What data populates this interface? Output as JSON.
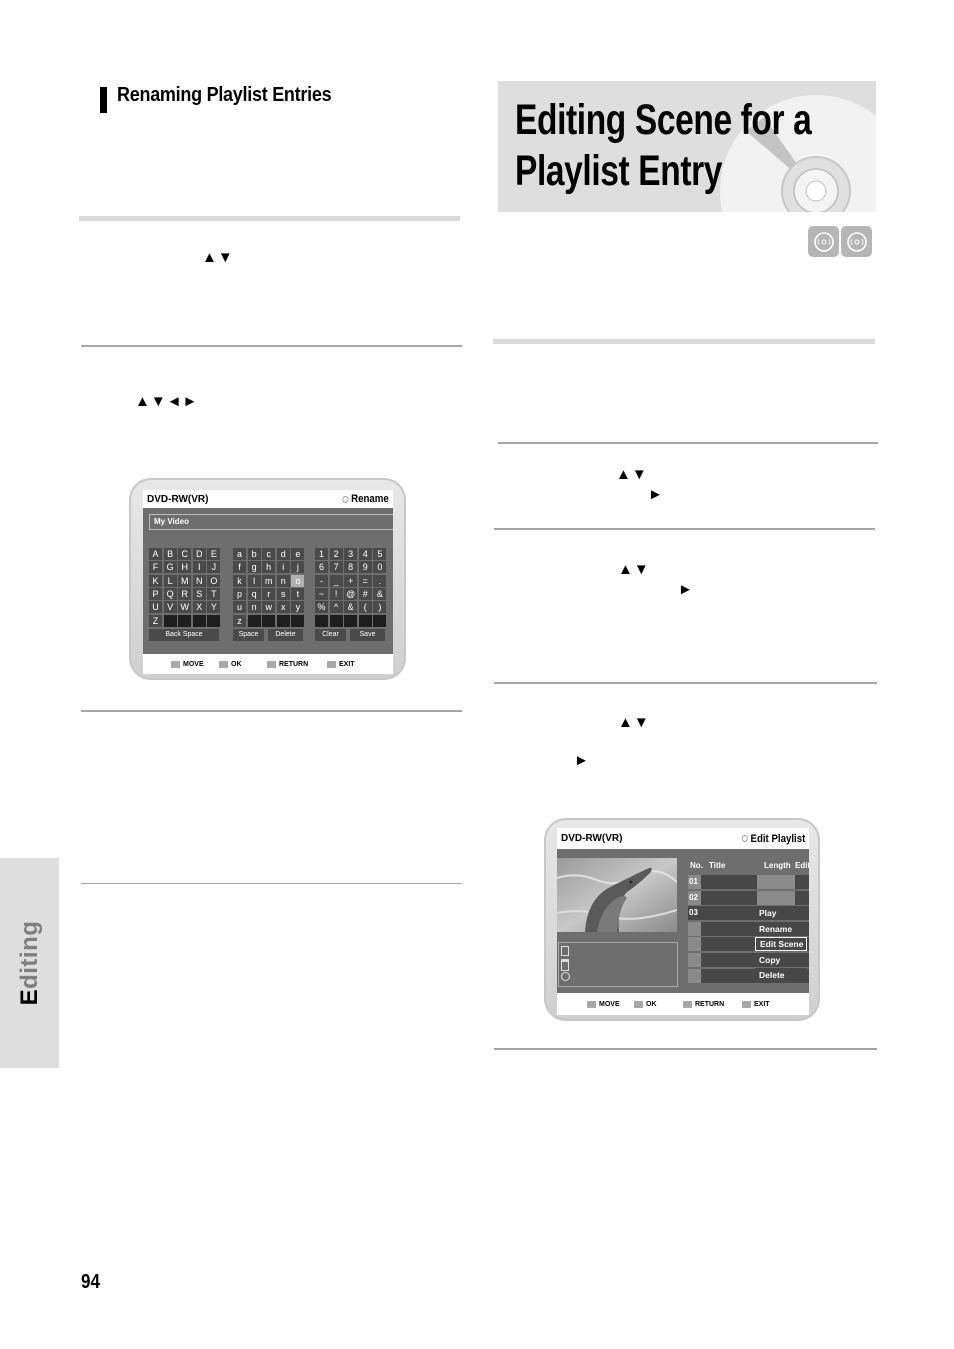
{
  "page": {
    "number": "94",
    "side_tab": {
      "first_letter": "E",
      "rest": "diting"
    }
  },
  "left_column": {
    "section_title": "Renaming Playlist Entries",
    "step_arrows": [
      "▲▼",
      "▲▼◄►"
    ],
    "rename_screen": {
      "disc_label": "DVD-RW(VR)",
      "mode_label": "Rename",
      "name_value": "My Video",
      "uppercase_keys": [
        "A",
        "B",
        "C",
        "D",
        "E",
        "F",
        "G",
        "H",
        "I",
        "J",
        "K",
        "L",
        "M",
        "N",
        "O",
        "P",
        "Q",
        "R",
        "S",
        "T",
        "U",
        "V",
        "W",
        "X",
        "Y",
        "Z",
        "",
        "",
        "",
        ""
      ],
      "lowercase_keys": [
        "a",
        "b",
        "c",
        "d",
        "e",
        "f",
        "g",
        "h",
        "i",
        "j",
        "k",
        "l",
        "m",
        "n",
        "o",
        "p",
        "q",
        "r",
        "s",
        "t",
        "u",
        "n",
        "w",
        "x",
        "y",
        "z",
        "",
        "",
        "",
        ""
      ],
      "symbol_keys": [
        "1",
        "2",
        "3",
        "4",
        "5",
        "6",
        "7",
        "8",
        "9",
        "0",
        "-",
        "_",
        "+",
        "=",
        ".",
        "~",
        "!",
        "@",
        "#",
        "&",
        "%",
        "^",
        "&",
        "(",
        ")",
        "",
        "",
        "",
        "",
        ""
      ],
      "selected_key": "o",
      "buttons": {
        "back_space": "Back Space",
        "space": "Space",
        "delete": "Delete",
        "clear": "Clear",
        "save": "Save"
      },
      "footer": {
        "move": "MOVE",
        "ok": "OK",
        "return": "RETURN",
        "exit": "EXIT"
      }
    }
  },
  "right_column": {
    "banner_title_line1": "Editing Scene for a",
    "banner_title_line2": "Playlist Entry",
    "disc_badges": [
      "dvd-rw-vr-icon",
      "dvd-ram-icon"
    ],
    "step_arrows": {
      "step1_updown": "▲▼",
      "step1_right": "►",
      "step2_updown": "▲▼",
      "step2_right": "►",
      "step3_updown": "▲▼",
      "step3_right": "►"
    },
    "edit_playlist_screen": {
      "disc_label": "DVD-RW(VR)",
      "mode_label": "Edit Playlist",
      "columns": {
        "no": "No.",
        "title": "Title",
        "length": "Length",
        "edit": "Edit"
      },
      "rows": [
        "01",
        "02",
        "03"
      ],
      "menu_items": [
        "Play",
        "Rename",
        "Edit Scene",
        "Copy",
        "Delete"
      ],
      "selected_menu_item": "Edit Scene",
      "footer": {
        "move": "MOVE",
        "ok": "OK",
        "return": "RETURN",
        "exit": "EXIT"
      }
    }
  }
}
